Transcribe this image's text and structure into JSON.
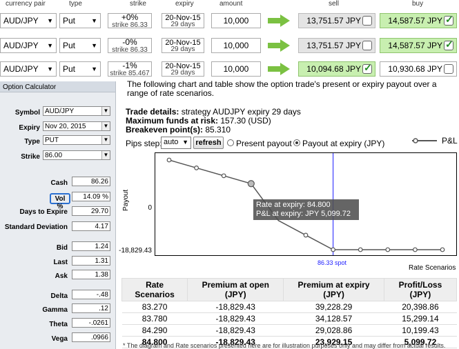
{
  "header": {
    "currency_pair": "currency pair",
    "type": "type",
    "strike": "strike",
    "expiry": "expiry",
    "amount": "amount",
    "sell": "sell",
    "buy": "buy"
  },
  "trades": [
    {
      "pair": "AUD/JPY",
      "type": "Put",
      "strike_pct": "+0%",
      "strike_val": "strike 86.33",
      "expiry_date": "20-Nov-15",
      "expiry_days": "29 days",
      "amount": "10,000",
      "sell": "13,751.57 JPY",
      "sell_checked": false,
      "buy": "14,587.57 JPY",
      "buy_checked": true
    },
    {
      "pair": "AUD/JPY",
      "type": "Put",
      "strike_pct": "-0%",
      "strike_val": "strike 86.33",
      "expiry_date": "20-Nov-15",
      "expiry_days": "29 days",
      "amount": "10,000",
      "sell": "13,751.57 JPY",
      "sell_checked": false,
      "buy": "14,587.57 JPY",
      "buy_checked": true
    },
    {
      "pair": "AUD/JPY",
      "type": "Put",
      "strike_pct": "-1%",
      "strike_val": "strike 85.467",
      "expiry_date": "20-Nov-15",
      "expiry_days": "29 days",
      "amount": "10,000",
      "sell": "10,094.68 JPY",
      "sell_checked": true,
      "buy": "10,930.68 JPY",
      "buy_checked": false
    }
  ],
  "calculator": {
    "title": "Option Calculator",
    "symbol_label": "Symbol",
    "symbol": "AUD/JPY",
    "expiry_label": "Expiry",
    "expiry": "Nov 20, 2015",
    "type_label": "Type",
    "type": "PUT",
    "strike_label": "Strike",
    "strike": "86.00",
    "cash_label": "Cash",
    "cash": "86.26",
    "vol_label": "Vol %",
    "vol": "14.09 %",
    "dte_label": "Days to Expire",
    "dte": "29.70",
    "sd_label": "Standard Deviation",
    "sd": "4.17",
    "bid_label": "Bid",
    "bid": "1.24",
    "last_label": "Last",
    "last": "1.31",
    "ask_label": "Ask",
    "ask": "1.38",
    "delta_label": "Delta",
    "delta": "-.48",
    "gamma_label": "Gamma",
    "gamma": ".12",
    "theta_label": "Theta",
    "theta": "-.0261",
    "vega_label": "Vega",
    "vega": ".0966"
  },
  "info": {
    "intro": "The following chart and table show the option trade's present or expiry payout over a range of rate scenarios.",
    "trade_details_label": "Trade details:",
    "trade_details": " strategy AUDJPY expiry 29 days",
    "max_funds_label": "Maximum funds at risk:",
    "max_funds": " 157.30 (USD)",
    "breakeven_label": "Breakeven point(s):",
    "breakeven": " 85.310",
    "pips_label": "Pips step:",
    "pips_value": "auto",
    "refresh": "refresh",
    "present_payout": "Present payout",
    "expiry_payout": "Payout at expiry (JPY)",
    "footnote": "* The diagram and Rate scenarios presented here are for illustration purposes only and may differ from actual results."
  },
  "chart_data": {
    "type": "line",
    "title": "",
    "xlabel": "Rate Scenarios",
    "ylabel": "Payout",
    "legend": "P&L",
    "legend_position": "top-right",
    "y_ticks": [
      "0",
      "-18,829.43"
    ],
    "ylim": [
      -18829.43,
      39228.29
    ],
    "spot_label": "86.33 spot",
    "spot": 86.33,
    "series": [
      {
        "name": "P&L",
        "x": [
          83.27,
          83.78,
          84.29,
          84.8,
          85.31,
          85.82,
          86.33,
          86.84,
          87.35,
          87.86,
          88.37
        ],
        "y": [
          39228.29,
          34128.57,
          29028.86,
          23929.15,
          0,
          -9414.7,
          -18829.43,
          -18829.43,
          -18829.43,
          -18829.43,
          -18829.43
        ]
      }
    ],
    "tooltip": {
      "line1": "Rate at expiry: 84.800",
      "line2": "P&L at expiry: JPY 5,099.72"
    }
  },
  "table": {
    "headers": [
      "Rate Scenarios",
      "Premium at open (JPY)",
      "Premium at expiry (JPY)",
      "Profit/Loss (JPY)"
    ],
    "rows": [
      [
        "83.270",
        "-18,829.43",
        "39,228.29",
        "20,398.86"
      ],
      [
        "83.780",
        "-18,829.43",
        "34,128.57",
        "15,299.14"
      ],
      [
        "84.290",
        "-18,829.43",
        "29,028.86",
        "10,199.43"
      ],
      [
        "84.800",
        "-18,829.43",
        "23,929.15",
        "5,099.72"
      ]
    ]
  }
}
